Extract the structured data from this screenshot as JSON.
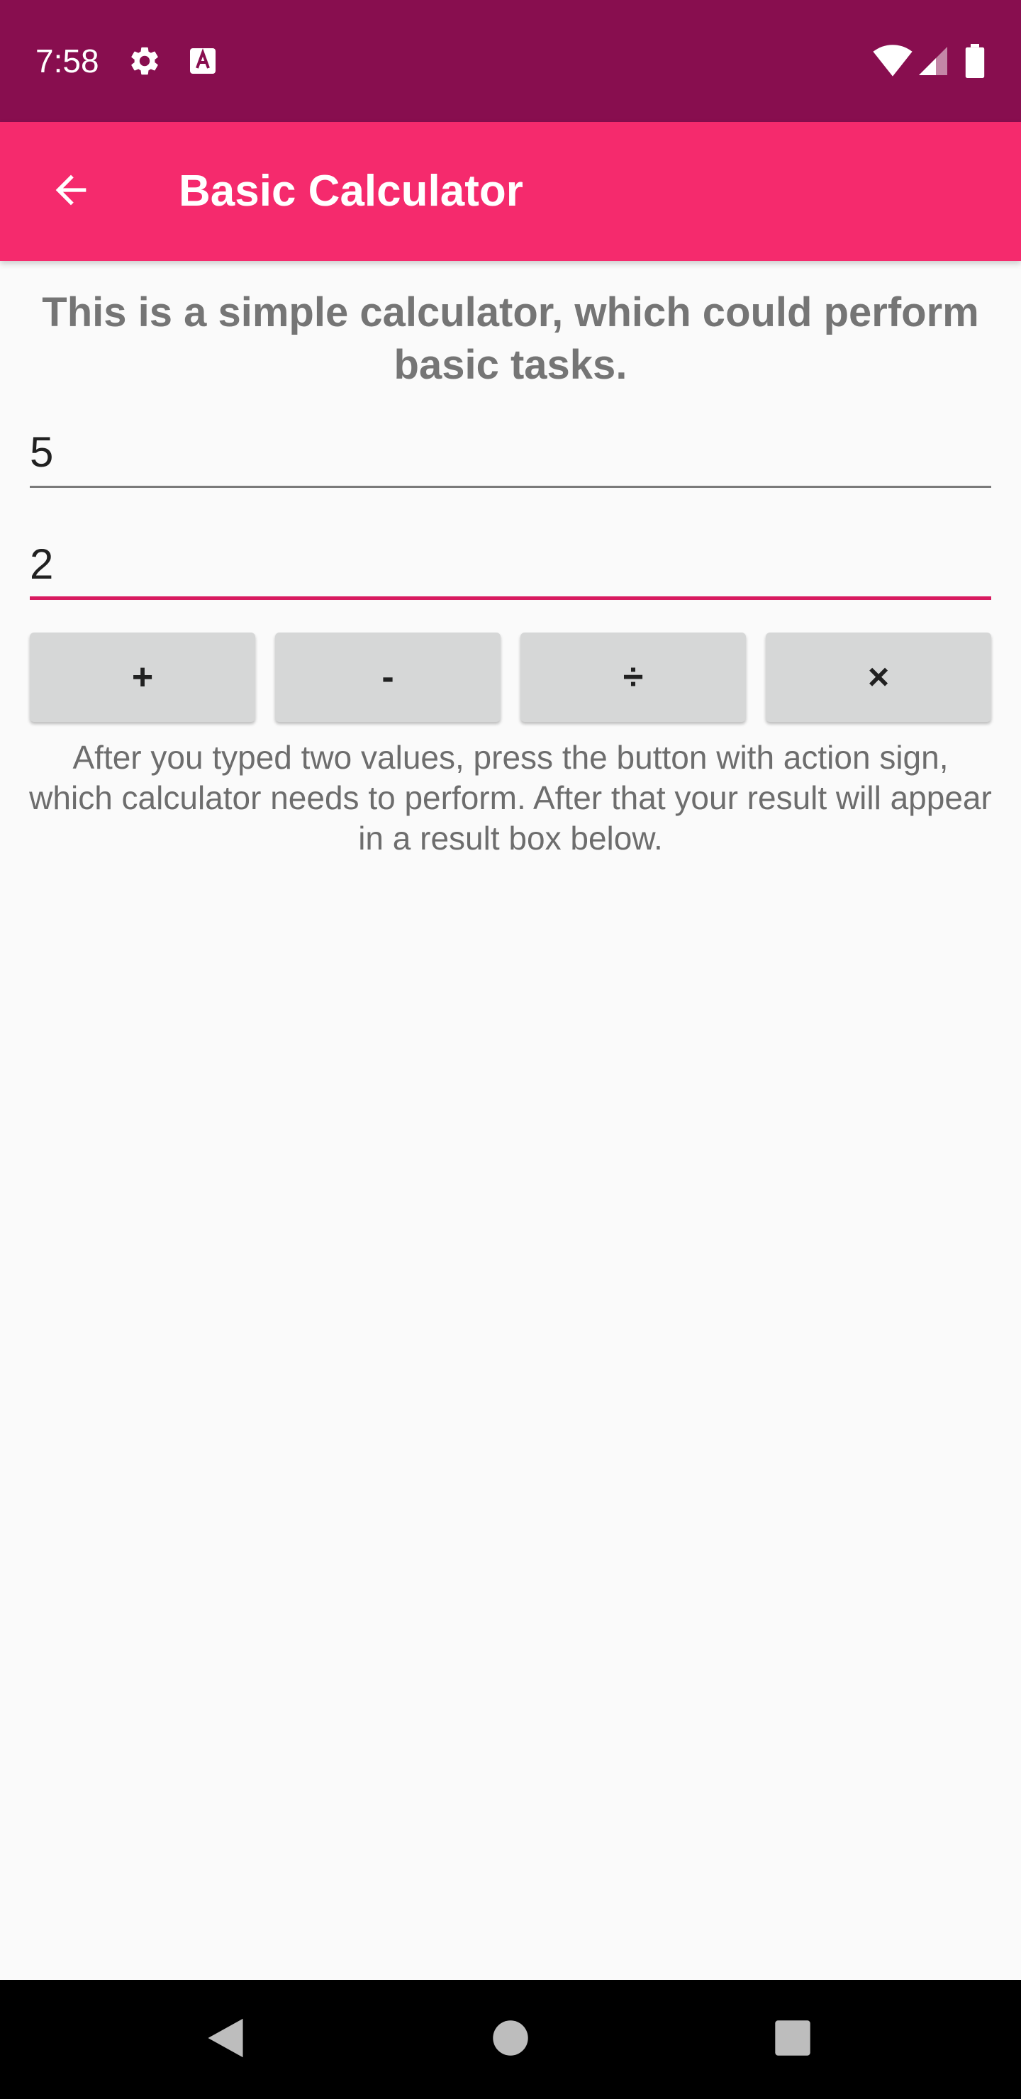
{
  "status_bar": {
    "time": "7:58",
    "icons": [
      "settings-icon",
      "text-a-icon",
      "wifi-icon",
      "cell-signal-icon",
      "battery-icon"
    ]
  },
  "app_bar": {
    "title": "Basic Calculator",
    "back_icon": "arrow-back-icon",
    "color": "#f52a6d"
  },
  "main": {
    "intro": "This is a simple calculator, which could perform basic tasks.",
    "first_value": "5",
    "second_value": "2",
    "operations": [
      {
        "label": "+"
      },
      {
        "label": "-"
      },
      {
        "label": "÷"
      },
      {
        "label": "×"
      }
    ],
    "help": "After you typed two values, press the button with action sign, which calculator needs to perform. After that your result will appear in a result box below."
  },
  "nav_bar": {
    "icons": [
      "back-triangle-icon",
      "home-circle-icon",
      "recents-square-icon"
    ]
  },
  "colors": {
    "status_bar": "#880e4f",
    "accent": "#d81b60",
    "background": "#fafafa"
  }
}
